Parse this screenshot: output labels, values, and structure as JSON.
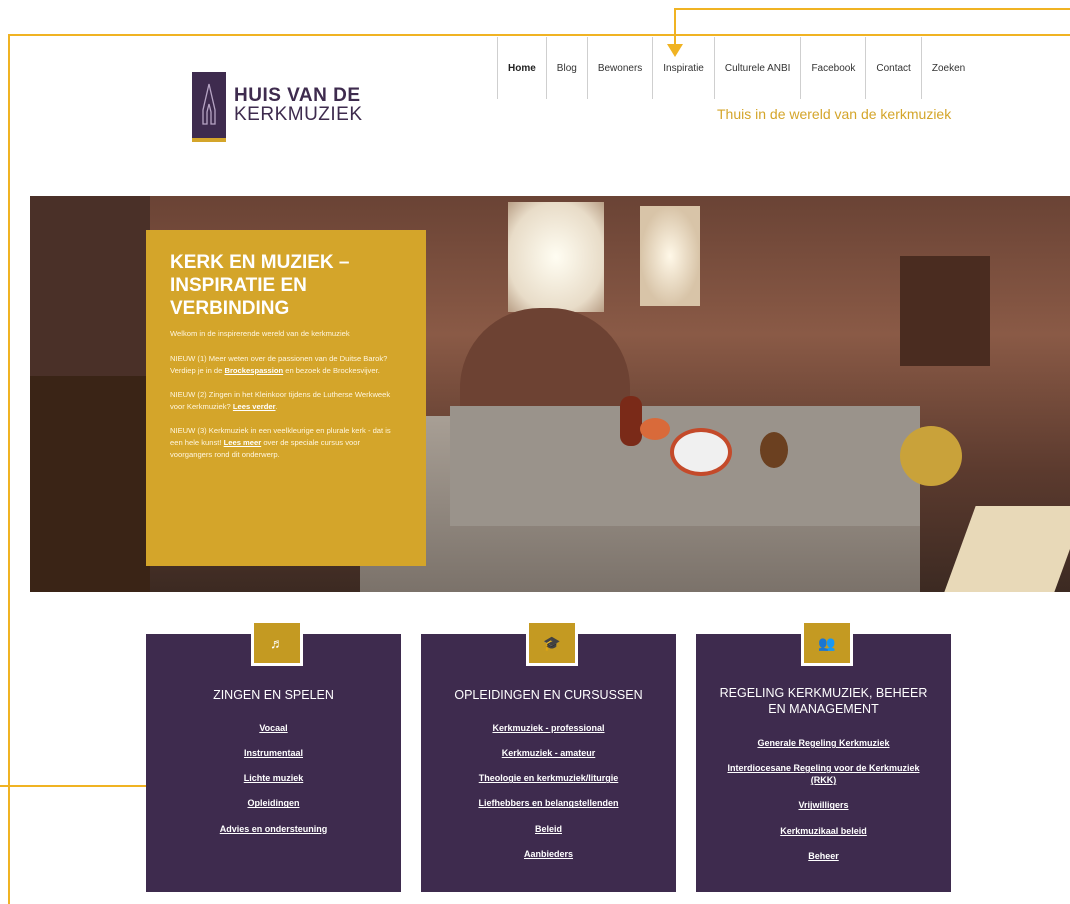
{
  "logo": {
    "line1": "HUIS VAN DE",
    "line2": "KERKMUZIEK"
  },
  "nav": {
    "items": [
      "Home",
      "Blog",
      "Bewoners",
      "Inspiratie",
      "Culturele ANBI",
      "Facebook",
      "Contact",
      "Zoeken"
    ],
    "active": "Home"
  },
  "tagline": "Thuis in de wereld van de kerkmuziek",
  "hero": {
    "title": "KERK EN MUZIEK – INSPIRATIE EN VERBINDING",
    "intro": "Welkom in de inspirerende wereld van de kerkmuziek",
    "news1": {
      "before": "NIEUW (1) Meer weten over de passionen van de Duitse Barok? Verdiep je in de ",
      "link": "Brockespassion",
      "after": " en bezoek de Brockesvijver."
    },
    "news2": {
      "before": "NIEUW (2) Zingen in het Kleinkoor tijdens de Lutherse Werkweek voor Kerkmuziek? ",
      "link": "Lees verder",
      "after": "."
    },
    "news3": {
      "before": "NIEUW (3) Kerkmuziek in een veelkleurige en plurale kerk - dat is een hele kunst! ",
      "link": "Lees meer",
      "after": " over de speciale cursus voor voorgangers rond dit onderwerp."
    }
  },
  "cards": [
    {
      "icon": "music-note-icon",
      "glyph": "♬",
      "title": "ZINGEN EN SPELEN",
      "links": [
        "Vocaal",
        "Instrumentaal",
        "Lichte muziek",
        "Opleidingen",
        "Advies en ondersteuning"
      ]
    },
    {
      "icon": "graduation-cap-icon",
      "glyph": "🎓",
      "title": "OPLEIDINGEN EN CURSUSSEN",
      "links": [
        "Kerkmuziek - professional",
        "Kerkmuziek - amateur",
        "Theologie en kerkmuziek/liturgie",
        "Liefhebbers en belangstellenden",
        "Beleid",
        "Aanbieders"
      ]
    },
    {
      "icon": "people-icon",
      "glyph": "👥",
      "title": "REGELING KERKMUZIEK, BEHEER EN MANAGEMENT",
      "links": [
        "Generale Regeling Kerkmuziek",
        "Interdiocesane Regeling voor de Kerkmuziek (RKK)",
        "Vrijwilligers",
        "Kerkmuzikaal beleid",
        "Beheer"
      ]
    }
  ],
  "colors": {
    "gold": "#d4a52a",
    "purple": "#3e2b4e",
    "annotation": "#f0b323"
  }
}
